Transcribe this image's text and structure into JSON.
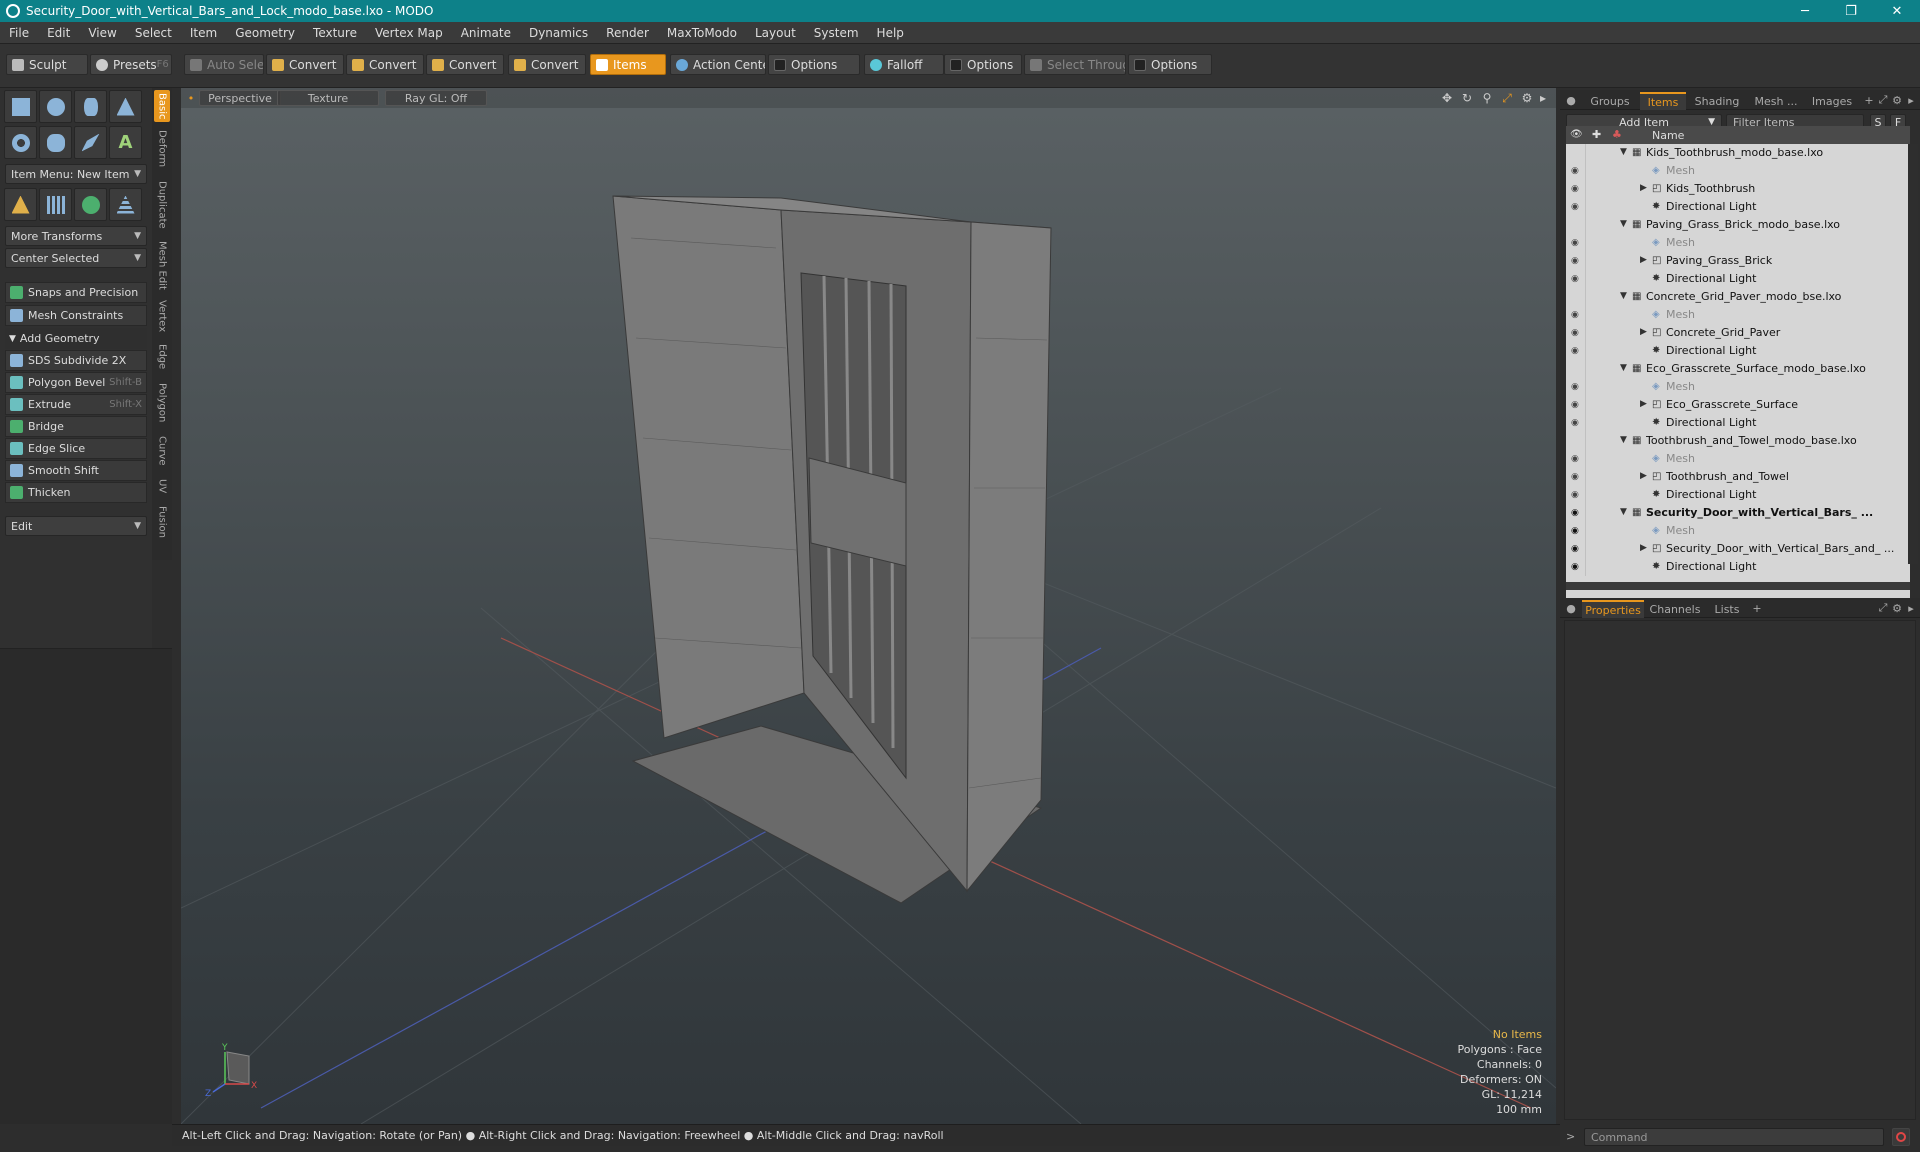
{
  "window": {
    "title": "Security_Door_with_Vertical_Bars_and_Lock_modo_base.lxo - MODO",
    "min": "─",
    "max": "❐",
    "close": "✕"
  },
  "menu": [
    "File",
    "Edit",
    "View",
    "Select",
    "Item",
    "Geometry",
    "Texture",
    "Vertex Map",
    "Animate",
    "Dynamics",
    "Render",
    "MaxToModo",
    "Layout",
    "System",
    "Help"
  ],
  "toolbar": {
    "sculpt": "Sculpt",
    "presets": "Presets",
    "presets_key": "F6",
    "auto_select": "Auto Select",
    "convert1": "Convert",
    "convert2": "Convert",
    "convert3": "Convert",
    "convert4": "Convert",
    "items": "Items",
    "action_center": "Action Center",
    "options1": "Options",
    "falloff": "Falloff",
    "options2": "Options",
    "select_through": "Select Through",
    "options3": "Options"
  },
  "left_panel": {
    "item_menu": "Item Menu: New Item",
    "more_transforms": "More Transforms",
    "center_selected": "Center Selected",
    "snaps": "Snaps and Precision",
    "mesh_constraints": "Mesh Constraints",
    "add_geometry": "Add Geometry",
    "tools": [
      {
        "label": "SDS Subdivide 2X",
        "shortcut": ""
      },
      {
        "label": "Polygon Bevel",
        "shortcut": "Shift-B"
      },
      {
        "label": "Extrude",
        "shortcut": "Shift-X"
      },
      {
        "label": "Bridge",
        "shortcut": ""
      },
      {
        "label": "Edge Slice",
        "shortcut": ""
      },
      {
        "label": "Smooth Shift",
        "shortcut": ""
      },
      {
        "label": "Thicken",
        "shortcut": ""
      }
    ],
    "edit": "Edit",
    "vtabs": [
      "Basic",
      "Deform",
      "Duplicate",
      "Mesh Edit",
      "Vertex",
      "Edge",
      "Polygon",
      "Curve",
      "UV",
      "Fusion"
    ]
  },
  "viewport": {
    "perspective": "Perspective",
    "texture": "Texture",
    "raygl": "Ray GL: Off",
    "info": {
      "no_items": "No Items",
      "polygons": "Polygons : Face",
      "channels": "Channels: 0",
      "deformers": "Deformers: ON",
      "gl": "GL: 11,214",
      "scale": "100 mm"
    },
    "axis": {
      "x": "X",
      "y": "Y",
      "z": "Z"
    }
  },
  "statusbar": "Alt-Left Click and Drag: Navigation: Rotate (or Pan) ● Alt-Right Click and Drag: Navigation: Freewheel ● Alt-Middle Click and Drag: navRoll",
  "right_panel": {
    "tabs": [
      "Groups",
      "Items",
      "Shading",
      "Mesh ...",
      "Images"
    ],
    "add_item": "Add Item",
    "filter_items": "Filter Items",
    "btn_s": "S",
    "btn_f": "F",
    "col_name": "Name",
    "tree": [
      {
        "depth": 0,
        "label": "Kids_Toothbrush_modo_base.lxo",
        "kind": "scene"
      },
      {
        "depth": 1,
        "label": "Mesh",
        "kind": "mesh"
      },
      {
        "depth": 1,
        "label": "Kids_Toothbrush",
        "kind": "group"
      },
      {
        "depth": 1,
        "label": "Directional Light",
        "kind": "light"
      },
      {
        "depth": 0,
        "label": "Paving_Grass_Brick_modo_base.lxo",
        "kind": "scene"
      },
      {
        "depth": 1,
        "label": "Mesh",
        "kind": "mesh"
      },
      {
        "depth": 1,
        "label": "Paving_Grass_Brick",
        "kind": "group"
      },
      {
        "depth": 1,
        "label": "Directional Light",
        "kind": "light"
      },
      {
        "depth": 0,
        "label": "Concrete_Grid_Paver_modo_bse.lxo",
        "kind": "scene"
      },
      {
        "depth": 1,
        "label": "Mesh",
        "kind": "mesh"
      },
      {
        "depth": 1,
        "label": "Concrete_Grid_Paver",
        "kind": "group"
      },
      {
        "depth": 1,
        "label": "Directional Light",
        "kind": "light"
      },
      {
        "depth": 0,
        "label": "Eco_Grasscrete_Surface_modo_base.lxo",
        "kind": "scene"
      },
      {
        "depth": 1,
        "label": "Mesh",
        "kind": "mesh"
      },
      {
        "depth": 1,
        "label": "Eco_Grasscrete_Surface",
        "kind": "group"
      },
      {
        "depth": 1,
        "label": "Directional Light",
        "kind": "light"
      },
      {
        "depth": 0,
        "label": "Toothbrush_and_Towel_modo_base.lxo",
        "kind": "scene"
      },
      {
        "depth": 1,
        "label": "Mesh",
        "kind": "mesh"
      },
      {
        "depth": 1,
        "label": "Toothbrush_and_Towel",
        "kind": "group"
      },
      {
        "depth": 1,
        "label": "Directional Light",
        "kind": "light"
      },
      {
        "depth": 0,
        "label": "Security_Door_with_Vertical_Bars_ ...",
        "kind": "scene",
        "bold": true
      },
      {
        "depth": 1,
        "label": "Mesh",
        "kind": "mesh"
      },
      {
        "depth": 1,
        "label": "Security_Door_with_Vertical_Bars_and_ ...",
        "kind": "group"
      },
      {
        "depth": 1,
        "label": "Directional Light",
        "kind": "light"
      }
    ],
    "props_tabs": [
      "Properties",
      "Channels",
      "Lists"
    ],
    "command": "Command"
  }
}
